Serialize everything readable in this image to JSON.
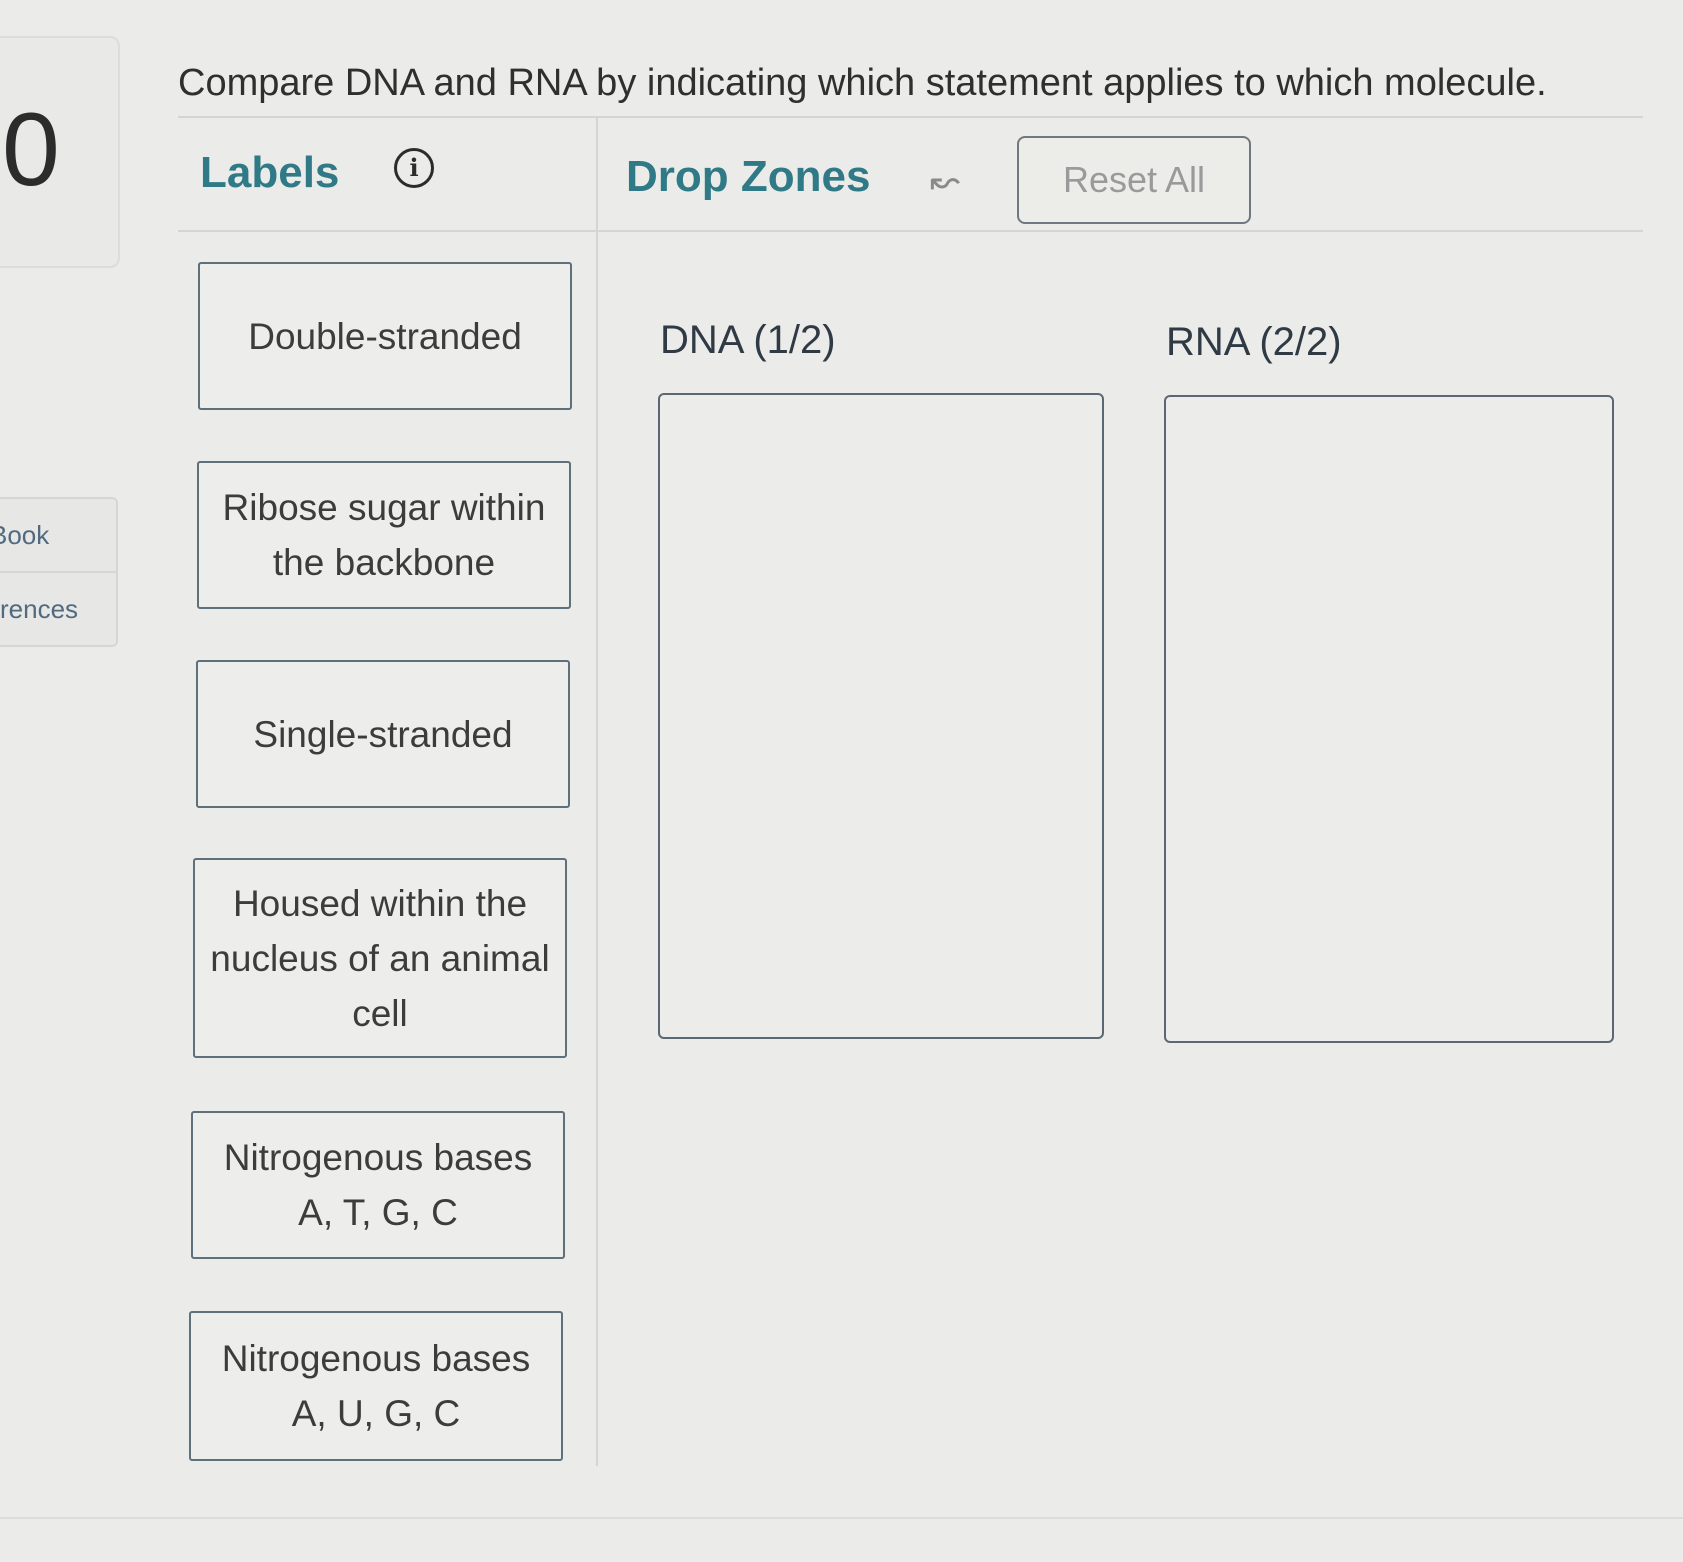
{
  "question": {
    "number": "0",
    "prompt": "Compare DNA and RNA by indicating which statement applies to which molecule."
  },
  "side_tabs": [
    "Book",
    "rences"
  ],
  "header": {
    "labels_title": "Labels",
    "info_icon": "i",
    "drop_zones_title": "Drop Zones",
    "undo_icon": "↜",
    "reset_label": "Reset All"
  },
  "labels": [
    {
      "text": "Double-stranded"
    },
    {
      "text": "Ribose sugar within the backbone"
    },
    {
      "text": "Single-stranded"
    },
    {
      "text": "Housed within the nucleus of an animal cell"
    },
    {
      "text": "Nitrogenous bases A, T, G, C"
    },
    {
      "text": "Nitrogenous bases A, U, G, C"
    }
  ],
  "drop_zones": [
    {
      "title": "DNA (1/2)"
    },
    {
      "title": "RNA (2/2)"
    }
  ],
  "colors": {
    "accent": "#2f7a86",
    "card_border": "#5f6f7c",
    "background": "#ebebe9"
  }
}
